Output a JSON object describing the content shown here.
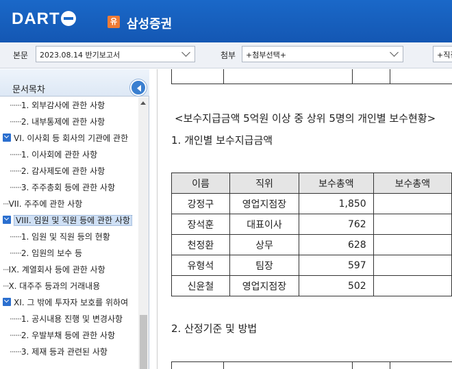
{
  "header": {
    "logo": "DART",
    "badge": "유",
    "company": "삼성증권"
  },
  "toolbar": {
    "main_label": "본문",
    "main_select": "2023.08.14  반기보고서",
    "attach_label": "첨부",
    "attach_select": "+첨부선택+",
    "extra_select": "+직접"
  },
  "sidebar": {
    "title": "문서목차",
    "items": [
      {
        "text": "1. 외부감사에 관한 사항",
        "level": 2
      },
      {
        "text": "2. 내부통제에 관한 사항",
        "level": 2
      },
      {
        "text": "VI. 이사회 등 회사의 기관에 관한",
        "level": 1,
        "expanded": true
      },
      {
        "text": "1. 이사회에 관한 사항",
        "level": 2
      },
      {
        "text": "2. 감사제도에 관한 사항",
        "level": 2
      },
      {
        "text": "3. 주주총회 등에 관한 사항",
        "level": 2
      },
      {
        "text": "VII. 주주에 관한 사항",
        "level": 1
      },
      {
        "text": "VIII. 임원 및 직원 등에 관한 사항",
        "level": 1,
        "expanded": true,
        "selected": true
      },
      {
        "text": "1. 임원 및 직원 등의 현황",
        "level": 2
      },
      {
        "text": "2. 임원의 보수 등",
        "level": 2
      },
      {
        "text": "IX. 계열회사 등에 관한 사항",
        "level": 1
      },
      {
        "text": "X. 대주주 등과의 거래내용",
        "level": 1
      },
      {
        "text": "XI. 그 밖에 투자자 보호를 위하여",
        "level": 1,
        "expanded": true
      },
      {
        "text": "1. 공시내용 진행 및 변경사항",
        "level": 2
      },
      {
        "text": "2. 우발부채 등에 관한 사항",
        "level": 2
      },
      {
        "text": "3. 제재 등과 관련된 사항",
        "level": 2
      }
    ]
  },
  "content": {
    "section_title": "<보수지급금액 5억원 이상 중 상위 5명의 개인별 보수현황>",
    "heading1": "1. 개인별 보수지급금액",
    "table": {
      "headers": [
        "이름",
        "직위",
        "보수총액",
        "보수총액"
      ],
      "rows": [
        {
          "name": "강정구",
          "position": "영업지점장",
          "amount": "1,850"
        },
        {
          "name": "장석훈",
          "position": "대표이사",
          "amount": "762"
        },
        {
          "name": "천정환",
          "position": "상무",
          "amount": "628"
        },
        {
          "name": "유형석",
          "position": "팀장",
          "amount": "597"
        },
        {
          "name": "신윤철",
          "position": "영업지점장",
          "amount": "502"
        }
      ]
    },
    "heading2": "2. 산정기준 및 방법"
  }
}
